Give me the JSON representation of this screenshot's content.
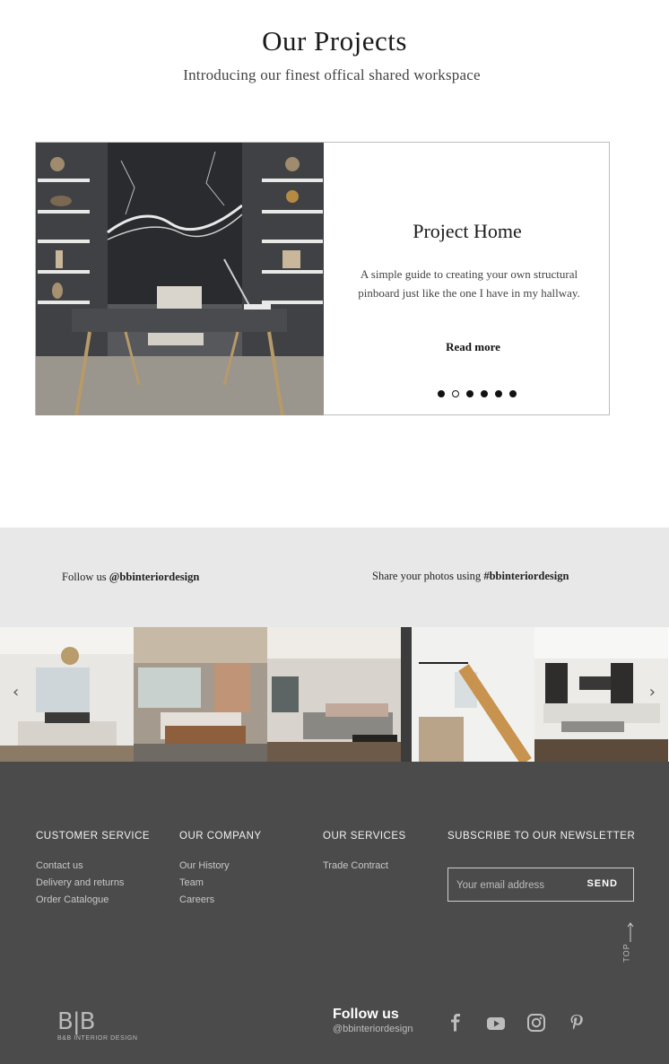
{
  "header": {
    "title": "Our Projects",
    "subtitle": "Introducing our finest offical shared workspace"
  },
  "project": {
    "title": "Project Home",
    "description": "A simple guide to creating your own structural pinboard just like the one I have in my hallway.",
    "read_more": "Read more",
    "slides_total": 6,
    "active_slide": 2
  },
  "social_band": {
    "follow_prefix": "Follow us",
    "follow_handle": "@bbinteriordesign",
    "share_prefix": "Share your photos using",
    "share_tag": "#bbinteriordesign"
  },
  "gallery": {
    "prev_icon": "chevron-left-icon",
    "next_icon": "chevron-right-icon"
  },
  "footer": {
    "columns": [
      {
        "heading": "CUSTOMER SERVICE",
        "links": [
          "Contact us",
          "Delivery and returns",
          "Order Catalogue"
        ]
      },
      {
        "heading": "OUR COMPANY",
        "links": [
          "Our History",
          "Team",
          "Careers"
        ]
      },
      {
        "heading": "OUR SERVICES",
        "links": [
          "Trade Contract"
        ]
      }
    ],
    "newsletter": {
      "heading": "SUBSCRIBE TO OUR NEWSLETTER",
      "placeholder": "Your email address",
      "button": "SEND"
    },
    "top_label": "TOP",
    "logo": {
      "letters": "B|B",
      "tagline": "B&B INTERIOR DESIGN"
    },
    "follow": {
      "heading": "Follow us",
      "handle": "@bbinteriordesign"
    },
    "social_icons": [
      "facebook-icon",
      "youtube-icon",
      "instagram-icon",
      "pinterest-icon"
    ]
  },
  "colors": {
    "footer_bg": "#4b4b4b",
    "band_bg": "#e8e8e8",
    "text_dark": "#222222"
  }
}
